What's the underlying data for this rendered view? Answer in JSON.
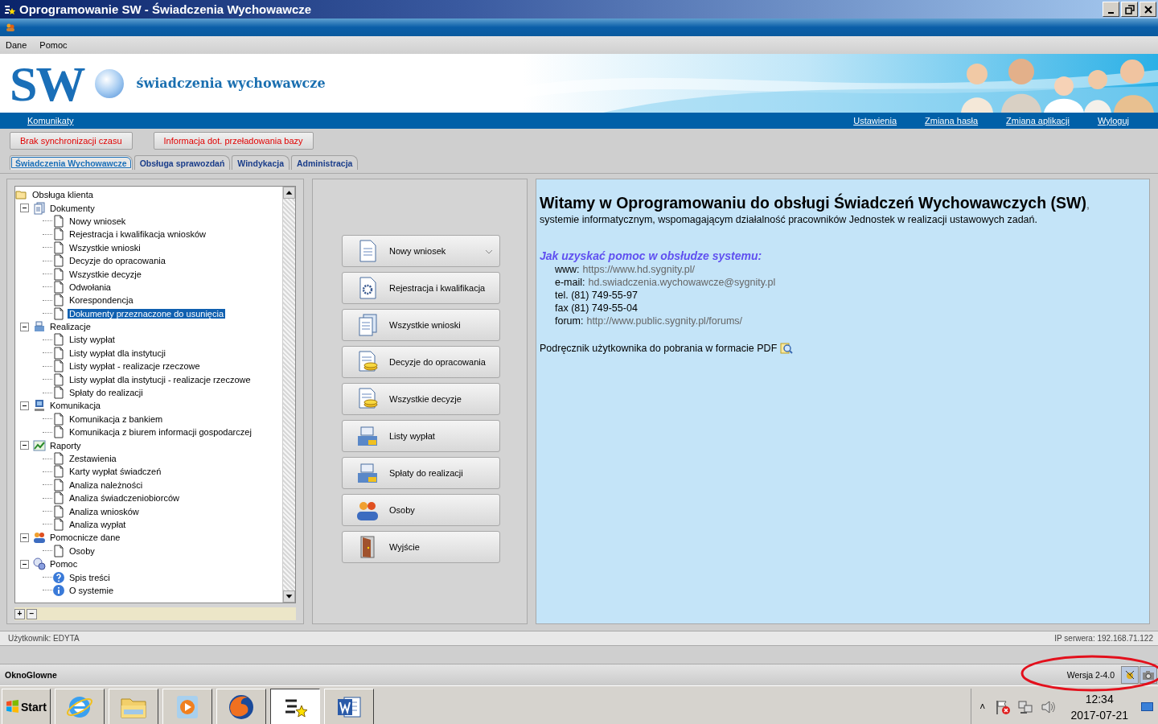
{
  "window": {
    "title": "Oprogramowanie SW - Świadczenia Wychowawcze"
  },
  "menu": [
    "Dane",
    "Pomoc"
  ],
  "header": {
    "logo": "SW",
    "title": "świadczenia wychowawcze"
  },
  "links_left": [
    "Komunikaty"
  ],
  "links_right": [
    "Ustawienia",
    "Zmiana hasła",
    "Zmiana aplikacji",
    "Wyloguj"
  ],
  "alerts": [
    "Brak synchronizacji czasu",
    "Informacja dot. przeładowania bazy"
  ],
  "tabs": [
    {
      "label": "Świadczenia Wychowawcze",
      "selected": true
    },
    {
      "label": "Obsługa sprawozdań",
      "selected": false
    },
    {
      "label": "Windykacja",
      "selected": false
    },
    {
      "label": "Administracja",
      "selected": false
    }
  ],
  "tree": [
    {
      "label": "Obsługa klienta",
      "kind": "folder",
      "selected": false,
      "children": [
        {
          "label": "Dokumenty",
          "kind": "documents",
          "selected": false,
          "expanded": true,
          "children": [
            {
              "label": "Nowy wniosek",
              "kind": "page",
              "selected": false
            },
            {
              "label": "Rejestracja i kwalifikacja wniosków",
              "kind": "page",
              "selected": false
            },
            {
              "label": "Wszystkie wnioski",
              "kind": "page",
              "selected": false
            },
            {
              "label": "Decyzje do opracowania",
              "kind": "page",
              "selected": false
            },
            {
              "label": "Wszystkie decyzje",
              "kind": "page",
              "selected": false
            },
            {
              "label": "Odwołania",
              "kind": "page",
              "selected": false
            },
            {
              "label": "Korespondencja",
              "kind": "page",
              "selected": false
            },
            {
              "label": "Dokumenty przeznaczone do usunięcia",
              "kind": "page",
              "selected": true
            }
          ]
        },
        {
          "label": "Realizacje",
          "kind": "register",
          "selected": false,
          "expanded": true,
          "children": [
            {
              "label": "Listy wypłat",
              "kind": "page",
              "selected": false
            },
            {
              "label": "Listy wypłat dla instytucji",
              "kind": "page",
              "selected": false
            },
            {
              "label": "Listy wypłat - realizacje rzeczowe",
              "kind": "page",
              "selected": false
            },
            {
              "label": "Listy wypłat dla instytucji - realizacje rzeczowe",
              "kind": "page",
              "selected": false
            },
            {
              "label": "Spłaty do realizacji",
              "kind": "page",
              "selected": false
            }
          ]
        },
        {
          "label": "Komunikacja",
          "kind": "computer",
          "selected": false,
          "expanded": true,
          "children": [
            {
              "label": "Komunikacja z bankiem",
              "kind": "page",
              "selected": false
            },
            {
              "label": "Komunikacja z biurem informacji gospodarczej",
              "kind": "page",
              "selected": false
            }
          ]
        },
        {
          "label": "Raporty",
          "kind": "chart",
          "selected": false,
          "expanded": true,
          "children": [
            {
              "label": "Zestawienia",
              "kind": "page",
              "selected": false
            },
            {
              "label": "Karty wypłat świadczeń",
              "kind": "page",
              "selected": false
            },
            {
              "label": "Analiza należności",
              "kind": "page",
              "selected": false
            },
            {
              "label": "Analiza świadczeniobiorców",
              "kind": "page",
              "selected": false
            },
            {
              "label": "Analiza wniosków",
              "kind": "page",
              "selected": false
            },
            {
              "label": "Analiza wypłat",
              "kind": "page",
              "selected": false
            }
          ]
        },
        {
          "label": "Pomocnicze dane",
          "kind": "people",
          "selected": false,
          "expanded": true,
          "children": [
            {
              "label": "Osoby",
              "kind": "page",
              "selected": false
            }
          ]
        },
        {
          "label": "Pomoc",
          "kind": "help",
          "selected": false,
          "expanded": true,
          "children": [
            {
              "label": "Spis treści",
              "kind": "question",
              "selected": false
            },
            {
              "label": "O systemie",
              "kind": "info",
              "selected": false
            }
          ]
        }
      ]
    }
  ],
  "tree_buttons": [
    "+",
    "−"
  ],
  "actions": [
    {
      "label": "Nowy wniosek",
      "kind": "document",
      "dropdown": true
    },
    {
      "label": "Rejestracja i kwalifikacja",
      "kind": "gear",
      "dropdown": false
    },
    {
      "label": "Wszystkie wnioski",
      "kind": "documents",
      "dropdown": false
    },
    {
      "label": "Decyzje do opracowania",
      "kind": "decision",
      "dropdown": false
    },
    {
      "label": "Wszystkie decyzje",
      "kind": "decision",
      "dropdown": false
    },
    {
      "label": "Listy wypłat",
      "kind": "register",
      "dropdown": false
    },
    {
      "label": "Spłaty do realizacji",
      "kind": "register",
      "dropdown": false
    },
    {
      "label": "Osoby",
      "kind": "people",
      "dropdown": false
    },
    {
      "label": "Wyjście",
      "kind": "door",
      "dropdown": false
    }
  ],
  "welcome": {
    "title": "Witamy w Oprogramowaniu do obsługi Świadczeń Wychowawczych (SW)",
    "title_suffix": ",",
    "subtitle": "systemie informatycznym, wspomagającym działalność pracowników Jednostek w realizacji ustawowych zadań.",
    "help_heading": "Jak uzyskać pomoc w obsłudze systemu:",
    "contacts": [
      {
        "label": "www:",
        "value": "https://www.hd.sygnity.pl/"
      },
      {
        "label": "e-mail:",
        "value": "hd.swiadczenia.wychowawcze@sygnity.pl"
      },
      {
        "label": "tel. (81) 749-55-97"
      },
      {
        "label": "fax (81) 749-55-04"
      },
      {
        "label": "forum:",
        "value": "http://www.public.sygnity.pl/forums/"
      }
    ],
    "manual": "Podręcznik użytkownika do pobrania w formacie PDF"
  },
  "status_bar": {
    "user": "Użytkownik: EDYTA",
    "server": "IP serwera: 192.168.71.122"
  },
  "footer": {
    "window_name": "OknoGlowne",
    "version": "Wersja 2-4.0"
  },
  "highlight": {
    "color": "#e3101c"
  },
  "taskbar": {
    "start": "Start",
    "apps": [
      {
        "kind": "globe",
        "selected": false
      },
      {
        "kind": "folder",
        "selected": false
      },
      {
        "kind": "player",
        "selected": false
      },
      {
        "kind": "browser",
        "selected": false
      },
      {
        "kind": "sw",
        "selected": true
      },
      {
        "kind": "word",
        "selected": false
      }
    ],
    "tray_expand": "˄",
    "time": "12:34",
    "date": "2017-07-21"
  }
}
